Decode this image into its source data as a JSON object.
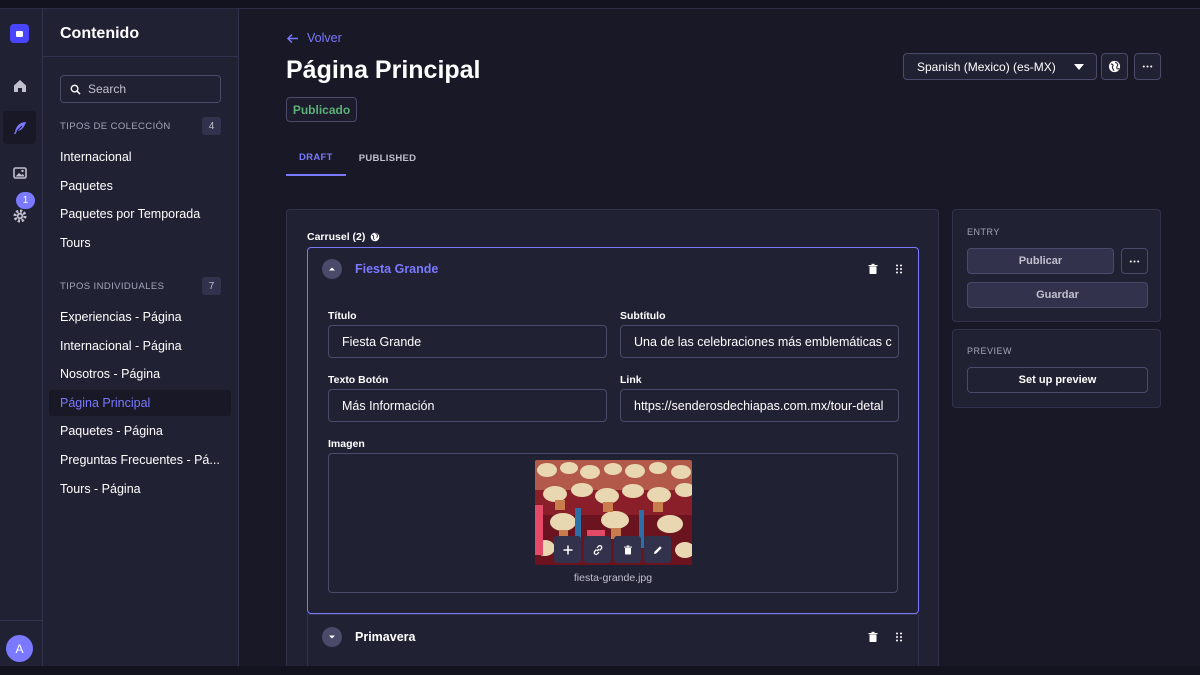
{
  "sidebar": {
    "title": "Contenido",
    "search_placeholder": "Search",
    "collection_types": {
      "label": "TIPOS DE COLECCIÓN",
      "count": "4",
      "items": [
        "Internacional",
        "Paquetes",
        "Paquetes por Temporada",
        "Tours"
      ]
    },
    "single_types": {
      "label": "TIPOS INDIVIDUALES",
      "count": "7",
      "items": [
        "Experiencias - Página",
        "Internacional - Página",
        "Nosotros - Página",
        "Página Principal",
        "Paquetes - Página",
        "Preguntas Frecuentes - Pá...",
        "Tours - Página"
      ]
    }
  },
  "rail": {
    "notification_count": "1",
    "avatar_initial": "A"
  },
  "header": {
    "back_label": "Volver",
    "page_title": "Página Principal",
    "status": "Publicado",
    "locale": "Spanish (Mexico) (es-MX)"
  },
  "tabs": [
    "DRAFT",
    "PUBLISHED"
  ],
  "editor": {
    "carousel_label": "Carrusel (2)",
    "components": [
      {
        "name": "Fiesta Grande",
        "fields": {
          "titulo_label": "Título",
          "titulo_value": "Fiesta Grande",
          "subtitulo_label": "Subtítulo",
          "subtitulo_value": "Una de las celebraciones más emblemáticas c",
          "texto_boton_label": "Texto Botón",
          "texto_boton_value": "Más Información",
          "link_label": "Link",
          "link_value": "https://senderosdechiapas.com.mx/tour-detal",
          "imagen_label": "Imagen",
          "imagen_filename": "fiesta-grande.jpg"
        }
      },
      {
        "name": "Primavera"
      }
    ]
  },
  "entry_panel": {
    "title": "ENTRY",
    "publish_label": "Publicar",
    "save_label": "Guardar"
  },
  "preview_panel": {
    "title": "PREVIEW",
    "setup_label": "Set up preview"
  },
  "colors": {
    "accent": "#7b79ff",
    "brand": "#4945ff",
    "success": "#5cb176",
    "background": "#181826",
    "panel": "#212134"
  }
}
